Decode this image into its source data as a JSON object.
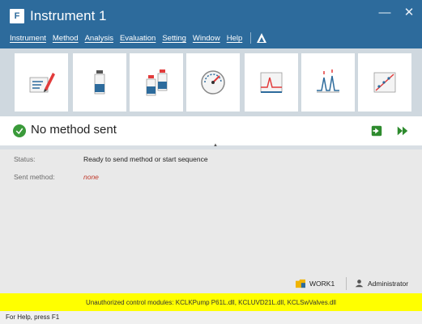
{
  "window": {
    "title": "Instrument 1",
    "app_icon_glyph": "F",
    "controls": {
      "minimize": "—",
      "close": "✕"
    }
  },
  "menu": {
    "items": [
      "Instrument",
      "Method",
      "Analysis",
      "Evaluation",
      "Setting",
      "Window",
      "Help"
    ]
  },
  "toolbar": {
    "icons": [
      "edit-method-icon",
      "single-sample-icon",
      "sequence-icon",
      "monitor-gauge-icon",
      "chromatogram-icon",
      "peak-integration-icon",
      "calibration-icon"
    ]
  },
  "status": {
    "title": "No method sent",
    "status_label": "Status:",
    "status_value": "Ready to send method or start sequence",
    "sent_label": "Sent method:",
    "sent_value": "none"
  },
  "footer": {
    "workspace": "WORK1",
    "user": "Administrator",
    "warning": "Unauthorized control modules: KCLKPump P61L.dll, KCLUVD21L.dll, KCLSwValves.dll",
    "help": "For Help, press F1"
  },
  "colors": {
    "titlebar": "#2d6b9c",
    "toolbar_bg": "#cfd8df",
    "info_bg": "#e9e9e9",
    "warning_bg": "#ffff00",
    "ok_green": "#3a9a3a",
    "none_red": "#c0392b"
  }
}
